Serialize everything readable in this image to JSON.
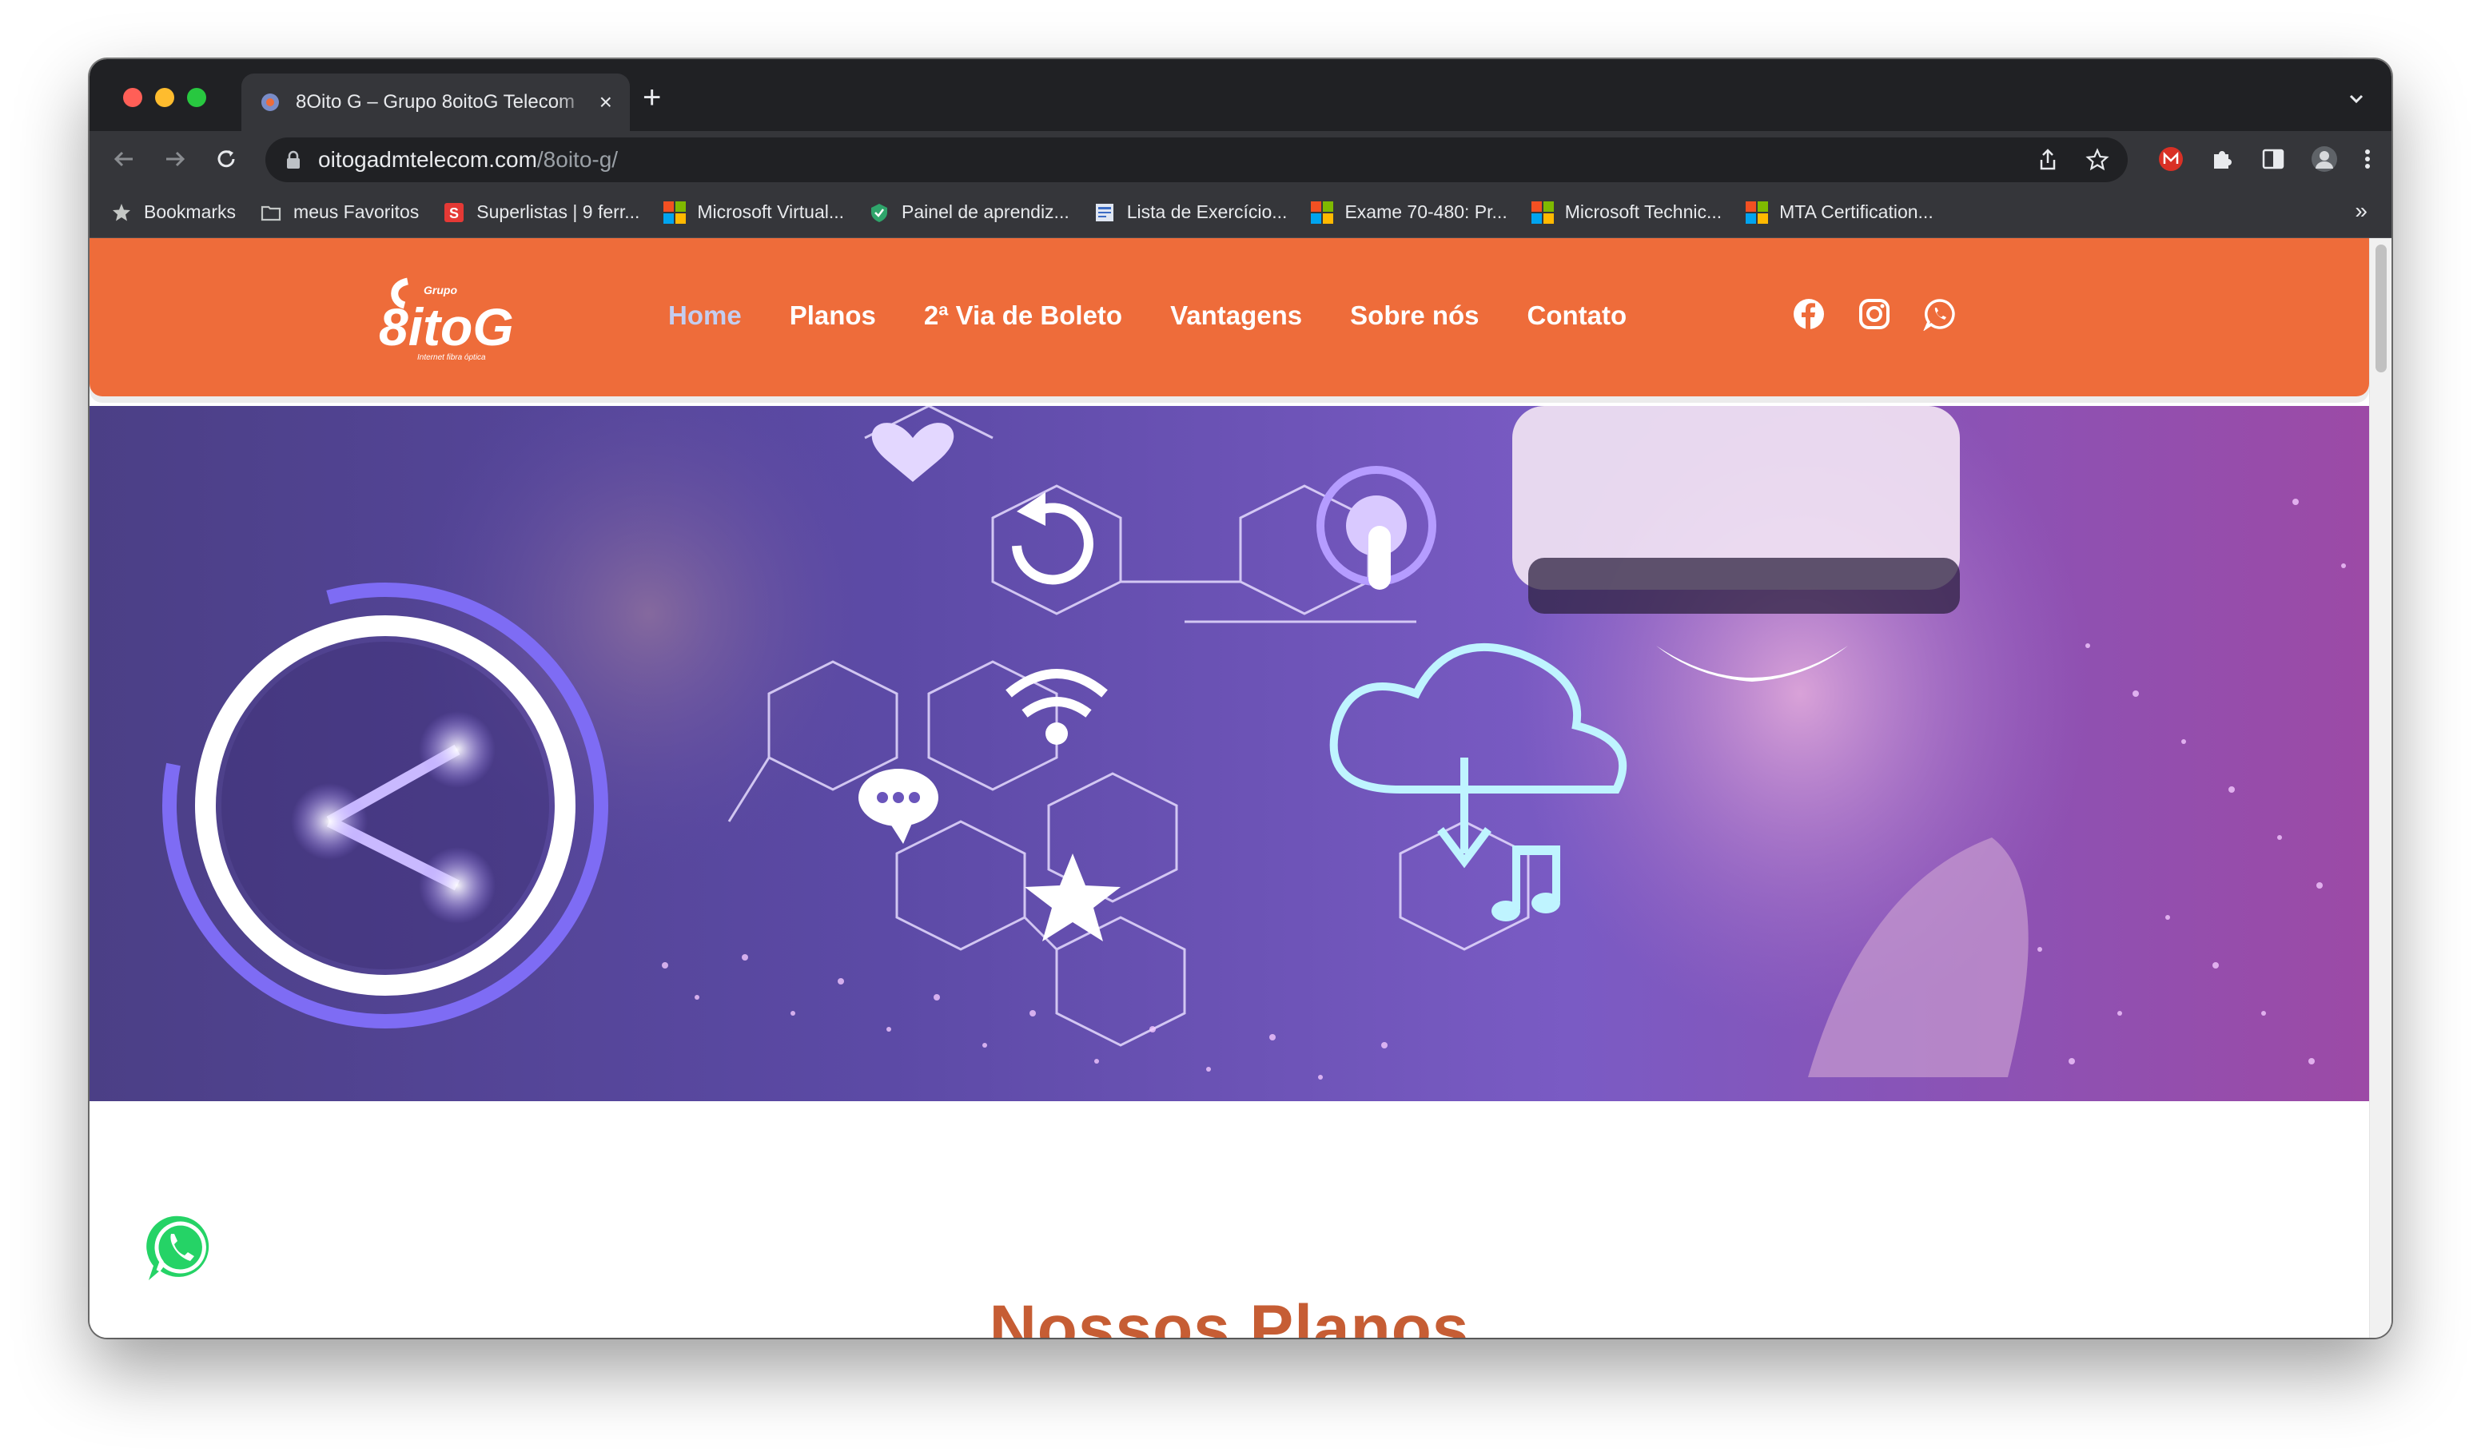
{
  "browser": {
    "tab_title": "8Oito G – Grupo 8oitoG Telecom",
    "url_host": "oitogadmtelecom.com",
    "url_path": "/8oito-g/"
  },
  "bookmarks": [
    {
      "label": "Bookmarks",
      "icon": "star-icon"
    },
    {
      "label": "meus Favoritos",
      "icon": "folder-icon"
    },
    {
      "label": "Superlistas | 9 ferr...",
      "icon": "superlistas-icon"
    },
    {
      "label": "Microsoft Virtual...",
      "icon": "microsoft-icon"
    },
    {
      "label": "Painel de aprendiz...",
      "icon": "shield-check-icon"
    },
    {
      "label": "Lista de Exercício...",
      "icon": "document-icon"
    },
    {
      "label": "Exame 70-480: Pr...",
      "icon": "microsoft-icon"
    },
    {
      "label": "Microsoft Technic...",
      "icon": "microsoft-icon"
    },
    {
      "label": "MTA Certification...",
      "icon": "microsoft-icon"
    }
  ],
  "bookmarks_more": "»",
  "site": {
    "logo_text": "8itoG",
    "logo_small_top": "Grupo",
    "logo_small_bottom": "Internet fibra óptica",
    "nav": [
      {
        "label": "Home",
        "active": true
      },
      {
        "label": "Planos",
        "active": false
      },
      {
        "label": "2ª Via de Boleto",
        "active": false
      },
      {
        "label": "Vantagens",
        "active": false
      },
      {
        "label": "Sobre nós",
        "active": false
      },
      {
        "label": "Contato",
        "active": false
      }
    ],
    "social": [
      "facebook-icon",
      "instagram-icon",
      "whatsapp-icon"
    ],
    "section_title": "Nossos Planos"
  },
  "colors": {
    "header_orange": "#ee6c3a",
    "active_nav": "#c4cdf0",
    "title_color": "#c65d34",
    "whatsapp_green": "#25d366"
  }
}
